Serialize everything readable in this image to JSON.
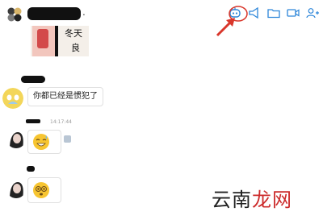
{
  "header": {
    "title_suffix": "."
  },
  "messages": [
    {
      "type": "sticker",
      "text": [
        "冬天",
        "良"
      ]
    },
    {
      "type": "text",
      "text": "你都已经是惯犯了"
    },
    {
      "type": "emoji",
      "time": "14:17:44",
      "emoji": "sweat-laugh-emoji"
    },
    {
      "type": "emoji",
      "emoji": "dizzy-face-emoji"
    }
  ],
  "watermark": {
    "part1": "云南",
    "part2": "龙网"
  },
  "colors": {
    "annotation": "#d9362b",
    "icon": "#2d86d9"
  }
}
